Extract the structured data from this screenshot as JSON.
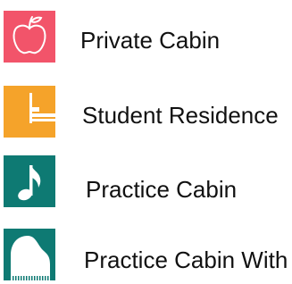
{
  "legend": {
    "items": [
      {
        "label": "Private Cabin",
        "icon": "apple-icon",
        "color": "#F2546A"
      },
      {
        "label": "Student Residence",
        "icon": "bed-icon",
        "color": "#F5A32A"
      },
      {
        "label": "Practice Cabin",
        "icon": "music-note-icon",
        "color": "#0E7A73"
      },
      {
        "label": "Practice Cabin With",
        "icon": "grand-piano-icon",
        "color": "#0E7A73"
      }
    ]
  }
}
